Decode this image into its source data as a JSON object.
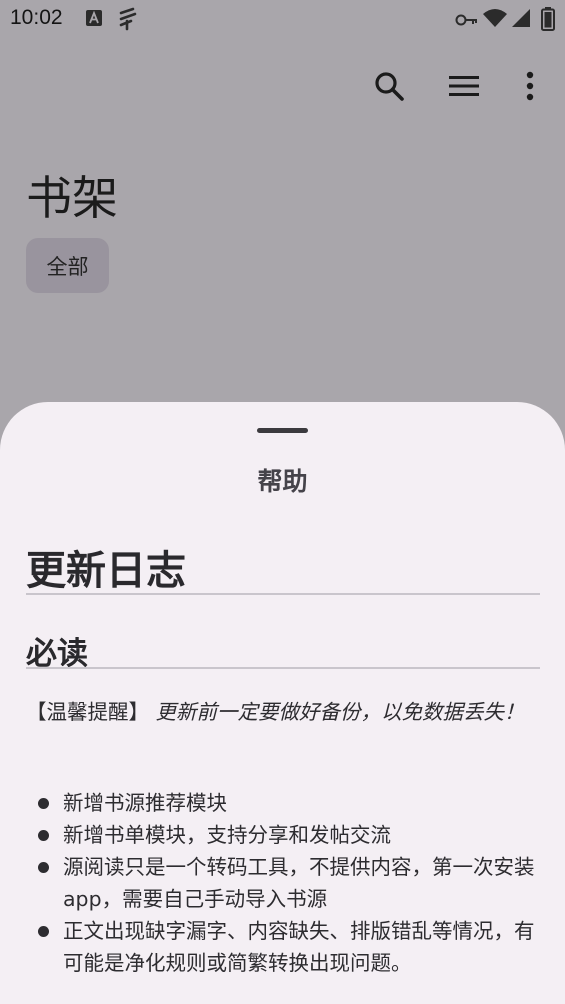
{
  "status_bar": {
    "time": "10:02",
    "icons": [
      "text-notification-icon",
      "app-notification-icon",
      "vpn-key-icon",
      "wifi-icon",
      "signal-icon",
      "battery-icon"
    ]
  },
  "toolbar": {
    "actions": [
      "search-icon",
      "menu-icon",
      "more-vert-icon"
    ]
  },
  "page": {
    "title": "书架",
    "group_chip": "全部"
  },
  "sheet": {
    "title": "帮助",
    "changelog_heading": "更新日志",
    "must_read_heading": "必读",
    "notice_label": "【温馨提醒】",
    "notice_emphasis": "更新前一定要做好备份，以免数据丢失！",
    "items": [
      "新增书源推荐模块",
      "新增书单模块，支持分享和发帖交流",
      "源阅读只是一个转码工具，不提供内容，第一次安装app，需要自己手动导入书源",
      "正文出现缺字漏字、内容缺失、排版错乱等情况，有可能是净化规则或简繁转换出现问题。"
    ]
  },
  "colors": {
    "scrim_background": "#a9a6ab",
    "sheet_background": "#f4eff4",
    "chip_background": "#99949e"
  }
}
